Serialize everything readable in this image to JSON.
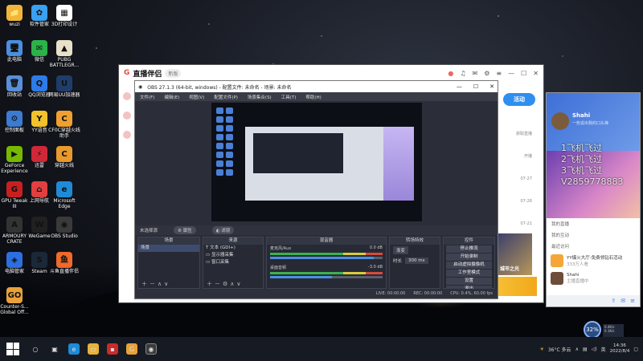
{
  "desktop": {
    "icons": [
      {
        "label": "wuzi",
        "color": "#f0b63a",
        "glyph": "📁"
      },
      {
        "label": "软件管家",
        "color": "#3aa0f0",
        "glyph": "✿"
      },
      {
        "label": "3D打印设计",
        "color": "#ffffff",
        "glyph": "▦"
      },
      {
        "label": "此电脑",
        "color": "#4a8fe0",
        "glyph": "🖥"
      },
      {
        "label": "微信",
        "color": "#2bb34a",
        "glyph": "✉"
      },
      {
        "label": "PUBG BATTLEGR...",
        "color": "#e8e0c8",
        "glyph": "▲"
      },
      {
        "label": "回收站",
        "color": "#5a8fd8",
        "glyph": "🗑"
      },
      {
        "label": "QQ浏览器",
        "color": "#2d7be8",
        "glyph": "Q"
      },
      {
        "label": "网易UU加速器",
        "color": "#1f3d6a",
        "glyph": "U"
      },
      {
        "label": "控制面板",
        "color": "#3c7bd2",
        "glyph": "⚙"
      },
      {
        "label": "YY语音",
        "color": "#f2c22b",
        "glyph": "Y"
      },
      {
        "label": "CF0C穿越火线助手",
        "color": "#f0a030",
        "glyph": "C"
      },
      {
        "label": "GeForce Experience",
        "color": "#76b900",
        "glyph": "▶"
      },
      {
        "label": "迅雷",
        "color": "#d02838",
        "glyph": "⚡"
      },
      {
        "label": "穿越火线",
        "color": "#e89a2c",
        "glyph": "C"
      },
      {
        "label": "GPU Tweak III",
        "color": "#c82020",
        "glyph": "G"
      },
      {
        "label": "上网导航",
        "color": "#e04040",
        "glyph": "⌂"
      },
      {
        "label": "Microsoft Edge",
        "color": "#1f8ad6",
        "glyph": "e"
      },
      {
        "label": "ARMOURY CRATE",
        "color": "#333333",
        "glyph": "A"
      },
      {
        "label": "WeGame",
        "color": "#202020",
        "glyph": "W"
      },
      {
        "label": "OBS Studio",
        "color": "#3a3a3a",
        "glyph": "◉"
      },
      {
        "label": "电脑管家",
        "color": "#2d6fe0",
        "glyph": "◈"
      },
      {
        "label": "Steam",
        "color": "#1b2838",
        "glyph": "S"
      },
      {
        "label": "斗鱼直播伴侣",
        "color": "#f06a2a",
        "glyph": "鱼"
      },
      {
        "label": "Counter-S... Global Off...",
        "color": "#e8a23a",
        "glyph": "GO"
      }
    ]
  },
  "zhibo": {
    "brand": "直播伴侣",
    "badge": "新版",
    "live_label": "活动",
    "side_labels": [
      "获取直播",
      "开播",
      "07-27",
      "07-26",
      "07-21",
      "07-11"
    ],
    "banner_text": "城市之光"
  },
  "obs": {
    "title": "OBS 27.1.3 (64-bit, windows) - 配置文件: 未命名 - 场景: 未命名",
    "menu": [
      "文件(F)",
      "编辑(E)",
      "视图(V)",
      "配置文件(P)",
      "场景集合(S)",
      "工具(T)",
      "帮助(H)"
    ],
    "scene_bar": {
      "label": "未选择源",
      "btn1": "属性",
      "btn2": "滤镜"
    },
    "docks": {
      "scenes": {
        "header": "场景",
        "items": [
          "场景"
        ]
      },
      "sources": {
        "header": "来源",
        "items": [
          "文本 (GDI+)",
          "显示器采集",
          "窗口采集"
        ]
      },
      "mixer": {
        "header": "混音器",
        "tracks": [
          {
            "name": "麦克风/Aux",
            "db": "0.0 dB",
            "level": 0.92
          },
          {
            "name": "桌面音频",
            "db": "-3.0 dB",
            "level": 0.55
          }
        ]
      },
      "transitions": {
        "header": "转场特效",
        "type": "渐变",
        "duration_label": "时长",
        "duration": "300 ms"
      },
      "controls": {
        "header": "控件",
        "buttons": [
          "停止推流",
          "开始录制",
          "启动虚拟摄像机",
          "工作室模式",
          "设置",
          "退出"
        ]
      }
    },
    "status": [
      "LIVE: 00:00:00",
      "REC: 00:00:00",
      "CPU: 0.4%, 60.00 fps"
    ]
  },
  "qq": {
    "name": "Shahi",
    "signature": "一些说出我的口头禅",
    "overlay": [
      "1飞机飞过",
      "2飞机飞过",
      "3飞机飞过",
      "V2859778883"
    ],
    "sections": [
      "我的直播",
      "我的互动",
      "最近访问"
    ],
    "items": [
      {
        "title": "YY爆火大厅-免费领钻石活动",
        "sub": "333万人看",
        "color": "#f4a63a"
      },
      {
        "title": "Shahi",
        "sub": "主播直播中",
        "color": "#6d4d3a"
      }
    ]
  },
  "cpu_widget": {
    "value": "32%",
    "detail": "0.4K/s 0.1K/s"
  },
  "taskbar": {
    "weather": "36°C 多云",
    "time": "14:36",
    "date": "2022/8/4",
    "lang": "英"
  }
}
